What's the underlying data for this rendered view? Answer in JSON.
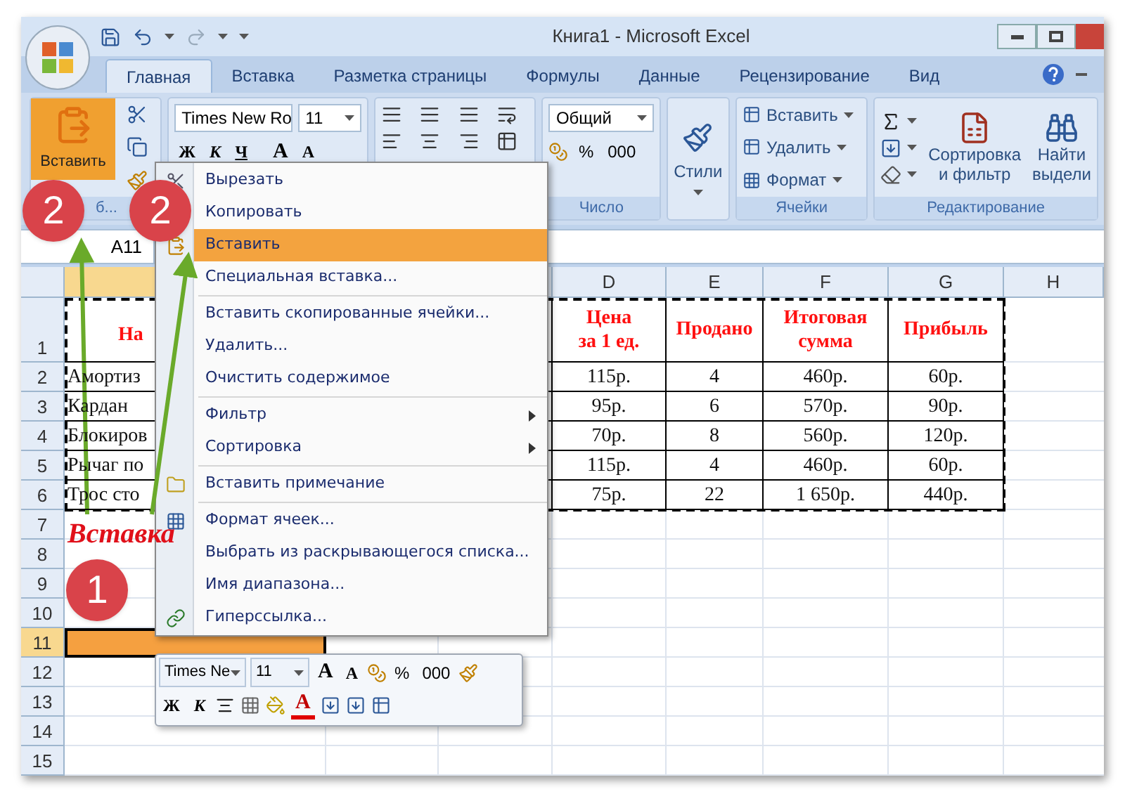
{
  "window": {
    "title": "Книга1 - Microsoft Excel"
  },
  "tabs": [
    {
      "label": "Главная",
      "selected": true
    },
    {
      "label": "Вставка",
      "selected": false
    },
    {
      "label": "Разметка страницы",
      "selected": false
    },
    {
      "label": "Формулы",
      "selected": false
    },
    {
      "label": "Данные",
      "selected": false
    },
    {
      "label": "Рецензирование",
      "selected": false
    },
    {
      "label": "Вид",
      "selected": false
    }
  ],
  "ribbon": {
    "clipboard": {
      "paste_label": "Вставить",
      "paste_highlighted": true,
      "group_label": "б..."
    },
    "font": {
      "font_name": "Times New Ro",
      "font_size": "11",
      "bold": "Ж",
      "italic": "К",
      "underline": "Ч",
      "grow": "A",
      "shrink": "A"
    },
    "number": {
      "format": "Общий",
      "percent": "%",
      "thousands": "000",
      "group_label": "Число"
    },
    "styles": {
      "label": "Стили"
    },
    "cells": {
      "items": [
        "Вставить",
        "Удалить",
        "Формат"
      ],
      "group_label": "Ячейки"
    },
    "editing": {
      "sort": [
        "Сортировка",
        "и фильтр"
      ],
      "find": [
        "Найти",
        "выдели"
      ],
      "group_label": "Редактирование"
    }
  },
  "name_box": "A11",
  "columns": [
    "D",
    "E",
    "F",
    "G",
    "H"
  ],
  "rows": [
    {
      "number": "1",
      "kind": "header",
      "selected": false,
      "a": [
        "На"
      ],
      "d": [
        "Цена",
        "за 1 ед."
      ],
      "e": [
        "Продано"
      ],
      "f": [
        "Итоговая",
        "сумма"
      ],
      "g": [
        "Прибыль"
      ]
    },
    {
      "number": "2",
      "kind": "data",
      "selected": false,
      "a": [
        "Амортиз"
      ],
      "d": [
        "115р."
      ],
      "e": [
        "4"
      ],
      "f": [
        "460р."
      ],
      "g": [
        "60р."
      ]
    },
    {
      "number": "3",
      "kind": "data",
      "selected": false,
      "a": [
        "Кардан"
      ],
      "d": [
        "95р."
      ],
      "e": [
        "6"
      ],
      "f": [
        "570р."
      ],
      "g": [
        "90р."
      ]
    },
    {
      "number": "4",
      "kind": "data",
      "selected": false,
      "a": [
        "Блокиров"
      ],
      "d": [
        "70р."
      ],
      "e": [
        "8"
      ],
      "f": [
        "560р."
      ],
      "g": [
        "120р."
      ]
    },
    {
      "number": "5",
      "kind": "data",
      "selected": false,
      "a": [
        "Рычаг по"
      ],
      "d": [
        "115р."
      ],
      "e": [
        "4"
      ],
      "f": [
        "460р."
      ],
      "g": [
        "60р."
      ]
    },
    {
      "number": "6",
      "kind": "data",
      "selected": false,
      "a": [
        "Трос сто"
      ],
      "d": [
        "75р."
      ],
      "e": [
        "22"
      ],
      "f": [
        "1 650р."
      ],
      "g": [
        "440р."
      ]
    },
    {
      "number": "7",
      "kind": "empty",
      "selected": false
    },
    {
      "number": "8",
      "kind": "empty",
      "selected": false
    },
    {
      "number": "9",
      "kind": "empty",
      "selected": false
    },
    {
      "number": "10",
      "kind": "empty",
      "selected": false
    },
    {
      "number": "11",
      "kind": "empty",
      "selected": true
    },
    {
      "number": "12",
      "kind": "empty",
      "selected": false
    },
    {
      "number": "13",
      "kind": "empty",
      "selected": false
    },
    {
      "number": "14",
      "kind": "empty",
      "selected": false
    },
    {
      "number": "15",
      "kind": "empty",
      "selected": false
    }
  ],
  "context_menu": {
    "groups": [
      [
        {
          "label": "Вырезать",
          "selected": false,
          "submenu": false
        },
        {
          "label": "Копировать",
          "selected": false,
          "submenu": false
        },
        {
          "label": "Вставить",
          "selected": true,
          "submenu": false
        },
        {
          "label": "Специальная вставка...",
          "selected": false,
          "submenu": false
        }
      ],
      [
        {
          "label": "Вставить скопированные ячейки...",
          "selected": false,
          "submenu": false
        },
        {
          "label": "Удалить...",
          "selected": false,
          "submenu": false
        },
        {
          "label": "Очистить содержимое",
          "selected": false,
          "submenu": false
        }
      ],
      [
        {
          "label": "Фильтр",
          "selected": false,
          "submenu": true
        },
        {
          "label": "Сортировка",
          "selected": false,
          "submenu": true
        }
      ],
      [
        {
          "label": "Вставить примечание",
          "selected": false,
          "submenu": false
        }
      ],
      [
        {
          "label": "Формат ячеек...",
          "selected": false,
          "submenu": false
        },
        {
          "label": "Выбрать из раскрывающегося списка...",
          "selected": false,
          "submenu": false
        },
        {
          "label": "Имя диапазона...",
          "selected": false,
          "submenu": false
        },
        {
          "label": "Гиперссылка...",
          "selected": false,
          "submenu": false
        }
      ]
    ]
  },
  "mini_toolbar": {
    "font_name": "Times Ne",
    "font_size": "11",
    "grow": "A",
    "shrink": "A",
    "percent": "%",
    "thousands": "000",
    "bold": "Ж",
    "italic": "К",
    "font_color": "A"
  },
  "annotation": {
    "text": "Вставка",
    "badges": [
      "2",
      "2",
      "1"
    ]
  }
}
